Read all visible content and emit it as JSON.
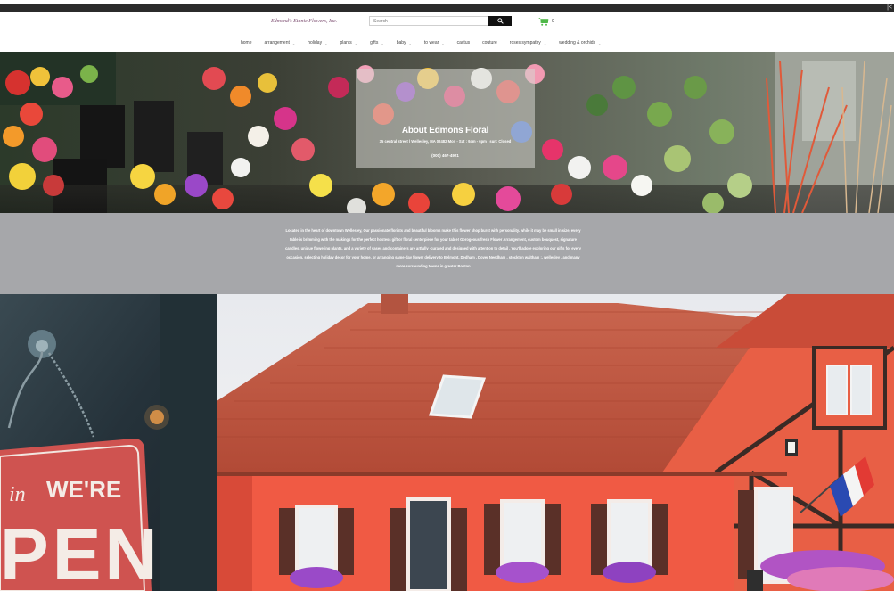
{
  "topbar": {
    "corner_label": "|<"
  },
  "brand": {
    "name": "Edmond's Ethnic Flowers, Inc."
  },
  "search": {
    "placeholder": "Search"
  },
  "cart": {
    "count": "0"
  },
  "nav": {
    "items": [
      {
        "label": "home",
        "has_dropdown": false
      },
      {
        "label": "arrangement",
        "has_dropdown": true
      },
      {
        "label": "holiday",
        "has_dropdown": true
      },
      {
        "label": "plants",
        "has_dropdown": true
      },
      {
        "label": "gifts",
        "has_dropdown": true
      },
      {
        "label": "baby",
        "has_dropdown": true
      },
      {
        "label": "to wear",
        "has_dropdown": true
      },
      {
        "label": "cactus",
        "has_dropdown": false
      },
      {
        "label": "couture",
        "has_dropdown": false
      },
      {
        "label": "roses sympathy",
        "has_dropdown": true
      },
      {
        "label": "wedding & orchids",
        "has_dropdown": true
      }
    ]
  },
  "hero": {
    "title": "About Edmons Floral",
    "address": "35 central street l Wellesley, MA 02482 Mon - Sat : 9am - 6pm l sun: Closed",
    "phone": "(000) 467-4921"
  },
  "about": {
    "text": "Located in the heart of downtown Wellesley, Our passionate florists and beautiful blooms make this flower shop burst with personality. while it may be small in size, every table is brimming with the makings for the perfect hostess gift or floral centerpiece for your table! Gorogeous fresh Flower Arrangement, custom bouquest, signature candles, unique flowering plants, and a variety of vases and containers are artfully -curated and designed with attention to detail . You'll adore exploring our gifts for every occasion, selecting holiday decor for your home, or arranging same-day flower delivery to Belmont, Dedham , Dover Needham , stockton waltham :, wellesley , and many more surrounding towns in greater Boston"
  },
  "images": {
    "left_sign_text_1": "WE'RE",
    "left_sign_text_2": "PEN",
    "left_sign_script": "in"
  },
  "colors": {
    "topbar": "#2b2b2b",
    "about_bg": "#a6a7aa",
    "cart": "#4fb848",
    "search_button": "#111111"
  }
}
